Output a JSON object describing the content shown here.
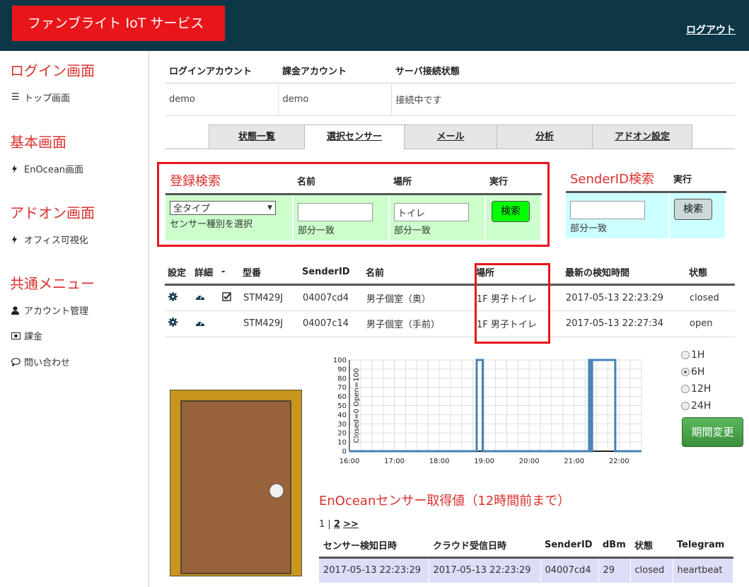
{
  "header": {
    "brand": "ファンブライト IoT サービス",
    "logout": "ログアウト"
  },
  "sidebar": {
    "sections": [
      {
        "title": "ログイン画面",
        "items": [
          {
            "icon": "list-icon",
            "label": "トップ画面"
          }
        ]
      },
      {
        "title": "基本画面",
        "items": [
          {
            "icon": "bolt-icon",
            "label": "EnOcean画面"
          }
        ]
      },
      {
        "title": "アドオン画面",
        "items": [
          {
            "icon": "bolt-icon",
            "label": "オフィス可視化"
          }
        ]
      },
      {
        "title": "共通メニュー",
        "items": [
          {
            "icon": "user-icon",
            "label": "アカウント管理"
          },
          {
            "icon": "money-icon",
            "label": "課金"
          },
          {
            "icon": "comment-icon",
            "label": "問い合わせ"
          }
        ]
      }
    ]
  },
  "account": {
    "headers": [
      "ログインアカウント",
      "課金アカウント",
      "サーバ接続状態"
    ],
    "values": [
      "demo",
      "demo",
      "接続中です"
    ]
  },
  "tabs": [
    "状態一覧",
    "選択センサー",
    "メール",
    "分析",
    "アドオン設定"
  ],
  "active_tab": "選択センサー",
  "reg_search": {
    "title": "登録検索",
    "name_header": "名前",
    "place_header": "場所",
    "exec_header": "実行",
    "type_select": "全タイプ",
    "type_hint": "センサー種別を選択",
    "name_value": "",
    "name_hint": "部分一致",
    "place_value": "トイレ",
    "place_hint": "部分一致",
    "search_button": "検索"
  },
  "senderid_search": {
    "title": "SenderID検索",
    "exec_header": "実行",
    "value": "",
    "hint": "部分一致",
    "search_button": "検索"
  },
  "sensors": {
    "headers": [
      "設定",
      "詳細",
      "-",
      "型番",
      "SenderID",
      "名前",
      "場所",
      "最新の検知時間",
      "状態"
    ],
    "rows": [
      {
        "checked": true,
        "model": "STM429J",
        "sender": "04007cd4",
        "name": "男子個室（奥）",
        "place": "1F 男子トイレ",
        "time": "2017-05-13 22:23:29",
        "state": "closed"
      },
      {
        "checked": false,
        "model": "STM429J",
        "sender": "04007c14",
        "name": "男子個室（手前）",
        "place": "1F 男子トイレ",
        "time": "2017-05-13 22:27:34",
        "state": "open"
      }
    ]
  },
  "chart_data": {
    "type": "line",
    "ylabel": "Closed=0 Open=100",
    "ylim": [
      0,
      100
    ],
    "yticks": [
      0,
      10,
      20,
      30,
      40,
      50,
      60,
      70,
      80,
      90,
      100
    ],
    "xlim": [
      "16:00",
      "22:30"
    ],
    "xticks": [
      "16:00",
      "17:00",
      "18:00",
      "19:00",
      "20:00",
      "21:00",
      "22:00"
    ],
    "grid": true,
    "series": [
      {
        "x": [
          "16:00",
          "18:50",
          "18:50",
          "18:58",
          "18:58",
          "21:20",
          "21:20",
          "21:23",
          "21:23",
          "21:24",
          "21:24",
          "21:55",
          "21:55",
          "22:30"
        ],
        "y": [
          0,
          0,
          100,
          100,
          0,
          0,
          100,
          100,
          0,
          0,
          100,
          100,
          0,
          0
        ]
      }
    ],
    "color": "#4682b4"
  },
  "periods": [
    "1H",
    "6H",
    "12H",
    "24H"
  ],
  "selected_period": "6H",
  "period_button": "期間変更",
  "enocean": {
    "title": "EnOceanセンサー取得値（12時間前まで）",
    "pager_current": "1",
    "pager_sep": "|",
    "pager_next_page": "2",
    "pager_next": ">>",
    "headers": [
      "センサー検知日時",
      "クラウド受信日時",
      "SenderID",
      "dBm",
      "状態",
      "Telegram"
    ],
    "rows": [
      [
        "2017-05-13 22:23:29",
        "2017-05-13 22:23:29",
        "04007cd4",
        "29",
        "closed",
        "heartbeat"
      ]
    ]
  }
}
